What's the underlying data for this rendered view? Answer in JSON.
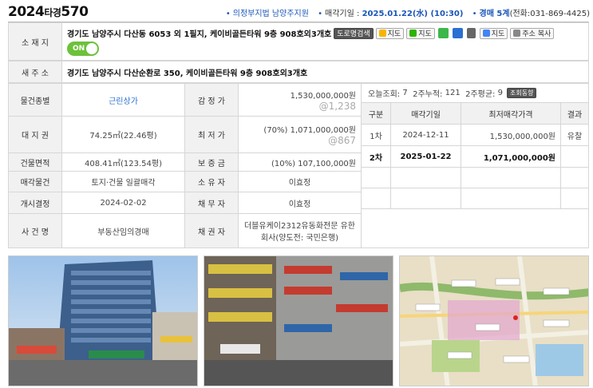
{
  "header": {
    "case_year": "2024",
    "case_type": "타경",
    "case_no": "570",
    "court": "의정부지법 남양주지원",
    "sale_date_label": "매각기일 :",
    "sale_date": "2025.01.22(水) (10:30)",
    "dept": "경매 5계",
    "phone": "(전화:031-869-4425)"
  },
  "address": {
    "label": "소 재 지",
    "value": "경기도 남양주시 다산동 6053 외 1필지, 케이비골든타워 9층 908호외3개호",
    "buttons": [
      "도로명검색",
      "지도",
      "지도",
      "지도",
      "주소 복사"
    ],
    "toggle": "ON"
  },
  "new_address": {
    "label": "새 주 소",
    "value": "경기도 남양주시 다산순환로 350, 케이비골든타워 9층 908호외3개호"
  },
  "rows": {
    "type_label": "물건종별",
    "type_value": "근린상가",
    "appraisal_label": "감 정 가",
    "appraisal_value": "1,530,000,000원",
    "appraisal_sub": "@1,238",
    "land_label": "대 지 권",
    "land_value": "74.25㎡(22.46평)",
    "min_label": "최 저 가",
    "min_value": "(70%) 1,071,000,000원",
    "min_sub": "@867",
    "bldg_label": "건물면적",
    "bldg_value": "408.41㎡(123.54평)",
    "deposit_label": "보 증 금",
    "deposit_value": "(10%) 107,100,000원",
    "sale_obj_label": "매각물건",
    "sale_obj_value": "토지·건물 일괄매각",
    "owner_label": "소 유 자",
    "owner_value": "이효정",
    "start_label": "개시결정",
    "start_value": "2024-02-02",
    "debtor_label": "채 무 자",
    "debtor_value": "이효정",
    "case_label": "사 건 명",
    "case_value": "부동산임의경매",
    "creditor_label": "채 권 자",
    "creditor_value_1": "더블유케이2312유동화전문 유한",
    "creditor_value_2": "회사(양도전: 국민은행)"
  },
  "stats": {
    "today_label": "오늘조회:",
    "today": "7",
    "two_week_label": "2주누적:",
    "two_week": "121",
    "avg_label": "2주평균:",
    "avg": "9",
    "button": "조회동향"
  },
  "history": {
    "headers": [
      "구분",
      "매각기일",
      "최저매각가격",
      "결과"
    ],
    "rows": [
      [
        "1차",
        "2024-12-11",
        "1,530,000,000원",
        "유찰"
      ],
      [
        "2차",
        "2025-01-22",
        "1,071,000,000원",
        ""
      ]
    ]
  },
  "colors": {
    "accent_blue": "#1a56b8",
    "label_bg": "#f1f1f1",
    "toggle_green": "#6dc13a"
  }
}
